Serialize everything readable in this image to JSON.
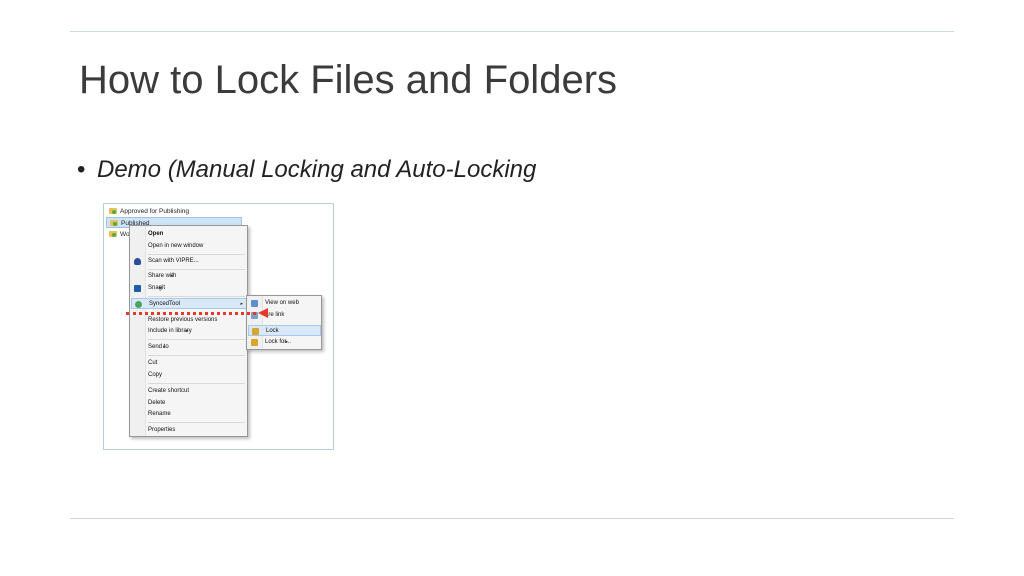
{
  "slide": {
    "title": "How to Lock Files and Folders",
    "bullet_symbol": "•",
    "bullet": "Demo (Manual Locking and Auto-Locking"
  },
  "explorer": {
    "items": [
      "Approved for Publishing",
      "Published",
      "Wo"
    ]
  },
  "context_menu": {
    "items": [
      {
        "label": "Open",
        "icon": "none"
      },
      {
        "label": "Open in new window",
        "icon": "none"
      },
      {
        "label": "Scan with VIPRE...",
        "icon": "vipre-shield-icon"
      },
      {
        "label": "Share with",
        "icon": "none"
      },
      {
        "label": "Snagit",
        "icon": "snagit-icon"
      },
      {
        "label": "SyncedTool",
        "icon": "syncedtool-icon"
      },
      {
        "label": "Restore previous versions",
        "icon": "none"
      },
      {
        "label": "Include in library",
        "icon": "none"
      },
      {
        "label": "Send to",
        "icon": "none"
      },
      {
        "label": "Cut",
        "icon": "none"
      },
      {
        "label": "Copy",
        "icon": "none"
      },
      {
        "label": "Create shortcut",
        "icon": "none"
      },
      {
        "label": "Delete",
        "icon": "none"
      },
      {
        "label": "Rename",
        "icon": "none"
      },
      {
        "label": "Properties",
        "icon": "none"
      }
    ],
    "submenu_arrow": "▸"
  },
  "submenu": {
    "items": [
      {
        "label": "View on web",
        "icon": "web-icon"
      },
      {
        "label": "are link",
        "icon": "share-link-icon"
      },
      {
        "label": "Lock",
        "icon": "lock-icon"
      },
      {
        "label": "Lock for...",
        "icon": "lock-icon"
      }
    ]
  },
  "colors": {
    "annotation": "#e53a2a",
    "highlight": "#d9e8f7"
  }
}
